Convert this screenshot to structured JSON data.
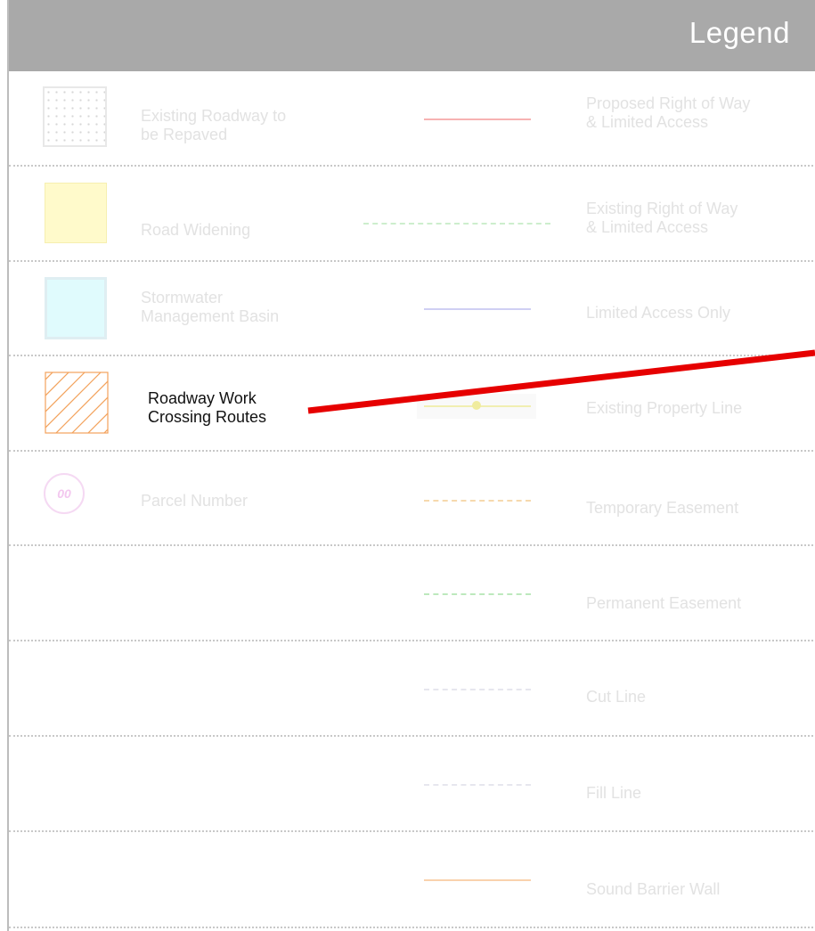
{
  "legend": {
    "title": "Legend",
    "left": [
      {
        "label": "Existing Roadway to\nbe Repaved",
        "symbol": "dotted-box-swatch",
        "faded": true
      },
      {
        "label": "Road Widening",
        "symbol": "yellow-swatch",
        "color": "#fff9c4",
        "faded": true
      },
      {
        "label": "Stormwater\nManagement Basin",
        "symbol": "cyan-swatch",
        "color": "#d8f7fb",
        "faded": true
      },
      {
        "label": "Roadway Work\nCrossing Routes",
        "symbol": "orange-hatch-swatch",
        "color": "#f3a25c",
        "faded": false
      },
      {
        "label": "Parcel Number",
        "symbol": "parcel-circle",
        "circle_text": "00",
        "color": "#f1c4ee",
        "faded": true
      }
    ],
    "right": [
      {
        "label": "Proposed Right of Way\n& Limited Access",
        "line_color": "#f6a8a8"
      },
      {
        "label": "Existing Right of Way\n& Limited Access",
        "line_color": "#c9f0c9"
      },
      {
        "label": "Limited Access Only",
        "line_color": "#c9c9f2"
      },
      {
        "label": "Existing Property Line",
        "line_color": "#f3f0b5"
      },
      {
        "label": "Temporary Easement",
        "line_color": "#f7d6a8"
      },
      {
        "label": "Permanent Easement",
        "line_color": "#b8efb8"
      },
      {
        "label": "Cut Line",
        "line_color": "#e3e3ee"
      },
      {
        "label": "Fill Line",
        "line_color": "#e3e3ee"
      },
      {
        "label": "Sound Barrier Wall",
        "line_color": "#f8cfaa"
      }
    ]
  },
  "annotation": {
    "pointer_color": "#e60000"
  }
}
